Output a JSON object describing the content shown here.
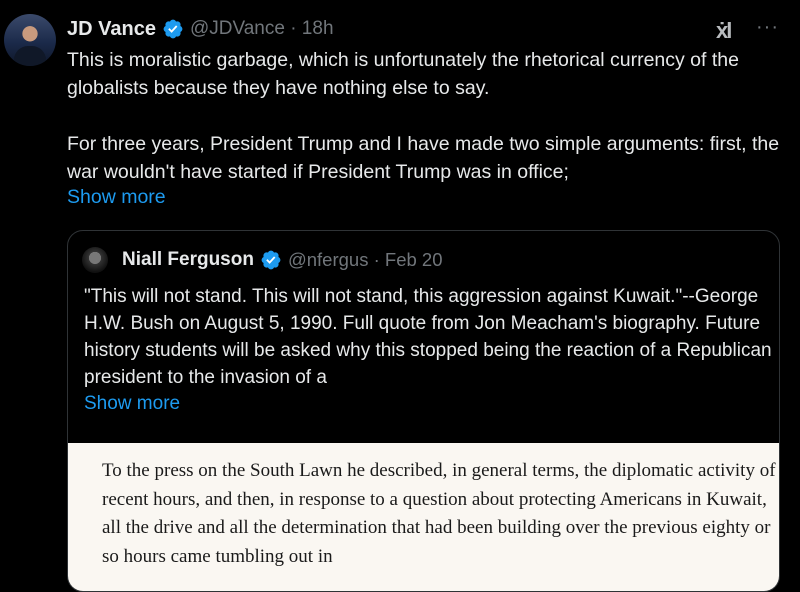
{
  "tweet": {
    "author_name": "JD Vance",
    "handle_time": "@JDVance · 18h",
    "logo_text": "ẋl",
    "more_label": "···",
    "paragraphs": [
      "This is moralistic garbage, which is unfortunately the rhetorical currency of the globalists because they have nothing else to say.",
      "For three years, President Trump and I have made two simple arguments: first, the war wouldn't have started if President Trump was in office;"
    ],
    "show_more": "Show more"
  },
  "quote": {
    "author_name": "Niall Ferguson",
    "handle_time": "@nfergus · Feb 20",
    "text": "\"This will not stand. This will not stand, this aggression against Kuwait.\"--George H.W. Bush on August 5, 1990. Full quote from Jon Meacham's biography. Future history students will be asked why this stopped being the reaction of a Republican president to the invasion of a",
    "show_more": "Show more",
    "image_text": "To the press on the South Lawn he described, in general terms, the diplomatic activity of recent hours, and then, in response to a question about protecting Americans in Kuwait, all the drive and all the determination that had been building over the previous eighty or so hours came tumbling out in"
  },
  "colors": {
    "link": "#1d9bf0",
    "verified": "#1d9bf0",
    "muted": "#71767b"
  },
  "icons": {
    "verified": "verified-badge-icon",
    "more": "more-options-icon",
    "logo": "grok-logo-icon"
  }
}
